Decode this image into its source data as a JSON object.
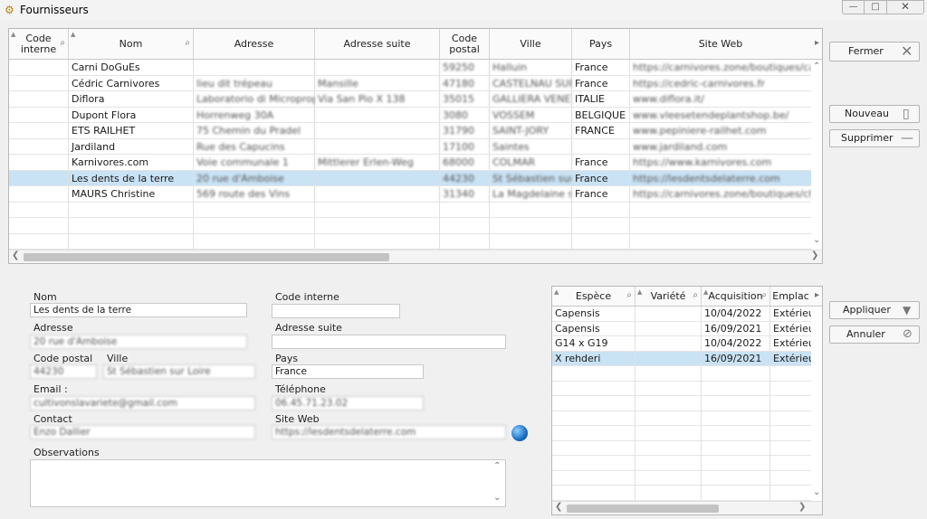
{
  "window": {
    "title": "Fournisseurs"
  },
  "supplier_grid": {
    "columns": [
      "Code interne",
      "Nom",
      "Adresse",
      "Adresse suite",
      "Code postal",
      "Ville",
      "Pays",
      "Site Web"
    ],
    "rows": [
      {
        "code": "",
        "nom": "Carni DoGuEs",
        "adresse": "",
        "adresse_suite": "",
        "cp": "59250",
        "ville": "Halluin",
        "pays": "France",
        "site": "https://carnivores.zone/boutiques/ca"
      },
      {
        "code": "",
        "nom": "Cédric Carnivores",
        "adresse": "lieu dit trépeau",
        "adresse_suite": "Mansille",
        "cp": "47180",
        "ville": "CASTELNAU SUR",
        "pays": "France",
        "site": "https://cedric-carnivores.fr"
      },
      {
        "code": "",
        "nom": "Diflora",
        "adresse": "Laboratorio di Micropropagazione",
        "adresse_suite": "Via San Pio X 138",
        "cp": "35015",
        "ville": "GALLIERA VENETA",
        "pays": "ITALIE",
        "site": "www.diflora.it/"
      },
      {
        "code": "",
        "nom": "Dupont Flora",
        "adresse": "Horrenweg 30A",
        "adresse_suite": "",
        "cp": "3080",
        "ville": "VOSSEM",
        "pays": "BELGIQUE",
        "site": "www.vleesetendeplantshop.be/"
      },
      {
        "code": "",
        "nom": "ETS RAILHET",
        "adresse": "75 Chemin du Pradel",
        "adresse_suite": "",
        "cp": "31790",
        "ville": "SAINT-JORY",
        "pays": "FRANCE",
        "site": "www.pepiniere-railhet.com"
      },
      {
        "code": "",
        "nom": "Jardiland",
        "adresse": "Rue des Capucins",
        "adresse_suite": "",
        "cp": "17100",
        "ville": "Saintes",
        "pays": "",
        "site": "www.jardiland.com"
      },
      {
        "code": "",
        "nom": "Karnivores.com",
        "adresse": "Voie communale 1",
        "adresse_suite": "Mittlerer Erlen-Weg",
        "cp": "68000",
        "ville": "COLMAR",
        "pays": "France",
        "site": "https://www.karnivores.com"
      },
      {
        "code": "",
        "nom": "Les dents de la terre",
        "adresse": "20 rue d'Amboise",
        "adresse_suite": "",
        "cp": "44230",
        "ville": "St Sébastien sur Loire",
        "pays": "France",
        "site": "https://lesdentsdelaterre.com"
      },
      {
        "code": "",
        "nom": "MAURS Christine",
        "adresse": "569 route des Vins",
        "adresse_suite": "",
        "cp": "31340",
        "ville": "La Magdelaine sur Tarn",
        "pays": "France",
        "site": "https://carnivores.zone/boutiques/ch"
      }
    ]
  },
  "buttons": {
    "fermer": "Fermer",
    "nouveau": "Nouveau",
    "supprimer": "Supprimer",
    "appliquer": "Appliquer",
    "annuler": "Annuler"
  },
  "form": {
    "nom": {
      "label": "Nom",
      "value": "Les dents de la terre"
    },
    "code_interne": {
      "label": "Code interne",
      "value": ""
    },
    "adresse": {
      "label": "Adresse",
      "value": "20 rue d'Amboise"
    },
    "adresse_suite": {
      "label": "Adresse suite",
      "value": ""
    },
    "code_postal": {
      "label": "Code postal",
      "value": "44230"
    },
    "ville": {
      "label": "Ville",
      "value": "St Sébastien sur Loire"
    },
    "pays": {
      "label": "Pays",
      "value": "France"
    },
    "email": {
      "label": "Email :",
      "value": "cultivonslavariete@gmail.com"
    },
    "telephone": {
      "label": "Téléphone",
      "value": "06.45.71.23.02"
    },
    "contact": {
      "label": "Contact",
      "value": "Enzo Dallier"
    },
    "site_web": {
      "label": "Site Web",
      "value": "https://lesdentsdelaterre.com"
    },
    "observations": {
      "label": "Observations",
      "value": ""
    }
  },
  "plants_grid": {
    "columns": [
      "Espèce",
      "Variété",
      "Acquisition",
      "Emplac"
    ],
    "rows": [
      {
        "espece": "Capensis",
        "variete": "",
        "acquisition": "10/04/2022",
        "emplacement": "Extérieu"
      },
      {
        "espece": "Capensis",
        "variete": "",
        "acquisition": "16/09/2021",
        "emplacement": "Extérieu"
      },
      {
        "espece": "G14 x G19",
        "variete": "",
        "acquisition": "10/04/2022",
        "emplacement": "Extérieu"
      },
      {
        "espece": "X rehderi",
        "variete": "",
        "acquisition": "16/09/2021",
        "emplacement": "Extérieu"
      }
    ]
  }
}
